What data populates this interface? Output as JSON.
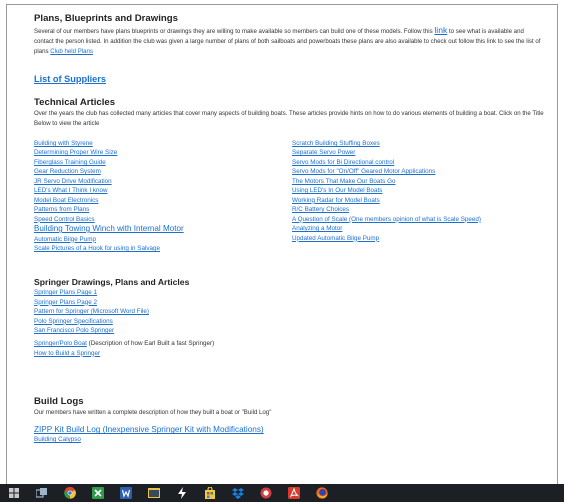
{
  "plans": {
    "title": "Plans, Blueprints and Drawings",
    "text1": "Several of our members have plans blueprints or drawings they are willing to make available so members can build one of these models. Follow this",
    "link_label": "link",
    "text2": "to see what is available and contact the person listed.  In addition the club was given a large number of plans of both sailboats and powerboats these plans are also available to check out follow this link to see the list of plans",
    "club_plans_link": "Club held Plans"
  },
  "suppliers": {
    "label": "List of Suppliers"
  },
  "technical": {
    "title": "Technical Articles",
    "intro": "Over the years the club has collected many articles that cover many aspects of building boats.  These articles provide hints on how to do various elements of building a boat. Click on the Title Below to view the article",
    "left": [
      "Building with Styrene",
      "Determining Proper Wire Size",
      "Fiberglass Training Guide",
      "Gear Reduction System",
      "JR Servo Drive Modification",
      "LED's What I Think I know",
      "Model Boat Electronics",
      "Patterns from Plans",
      "Speed Control Basics",
      "Building Towing Winch with Internal Motor",
      "Automatic Bilge Pump",
      "Scale Pictures of a Hook for using in Salvage"
    ],
    "right": [
      "Scratch Building Stuffing Boxes",
      "Separate Servo Power",
      "Servo Mods for Bi Directional control",
      "Servo Mods for \"On/Off\" Geared Motor Applications",
      "The Motors That Make Our Boats Go",
      "Using LED's In Our Model Boats",
      "Working Radar for Model Boats",
      "R/C Battery Choices",
      "A Question of Scale (One members opinion of what is Scale Speed)",
      "Analyzing a Motor",
      "Updated Automatic Bilge Pump"
    ]
  },
  "springer": {
    "title": "Springer Drawings, Plans and Articles",
    "items": [
      "Springer Plans Page 1",
      "Springer Plans Page 2",
      "Pattern for Springer (Microsoft Word File)",
      "Polo Springer Specifications",
      "San Francisco Polo Springer",
      "Springer/Polo Boat"
    ],
    "polo_desc": " (Description of how Earl Built a fast Springer)",
    "last": "How to Build a Springer"
  },
  "build_logs": {
    "title": "Build Logs",
    "intro": "Our members have written a complete description of how they built a boat or \"Build Log\"",
    "zipp": "ZIPP Kit Build Log (Inexpensive Springer Kit with Modifications)",
    "calypso": "Building Calypso"
  },
  "taskbar": {
    "icons": [
      "start-icon",
      "task-view-icon",
      "chrome-icon",
      "spreadsheet-icon",
      "word-icon",
      "minimized-window-icon",
      "power-icon",
      "store-icon",
      "dropbox-icon",
      "app-circle-icon",
      "acrobat-icon",
      "firefox-icon"
    ],
    "colors": [
      "#c9c9c9",
      "#9fb4c8",
      "#e0a624",
      "#2f9a48",
      "#2d5fb0",
      "#e7c34a",
      "#ffffff",
      "#f0c848",
      "#1a7fe0",
      "#d04040",
      "#d63b2b",
      "#e86a1c"
    ]
  }
}
